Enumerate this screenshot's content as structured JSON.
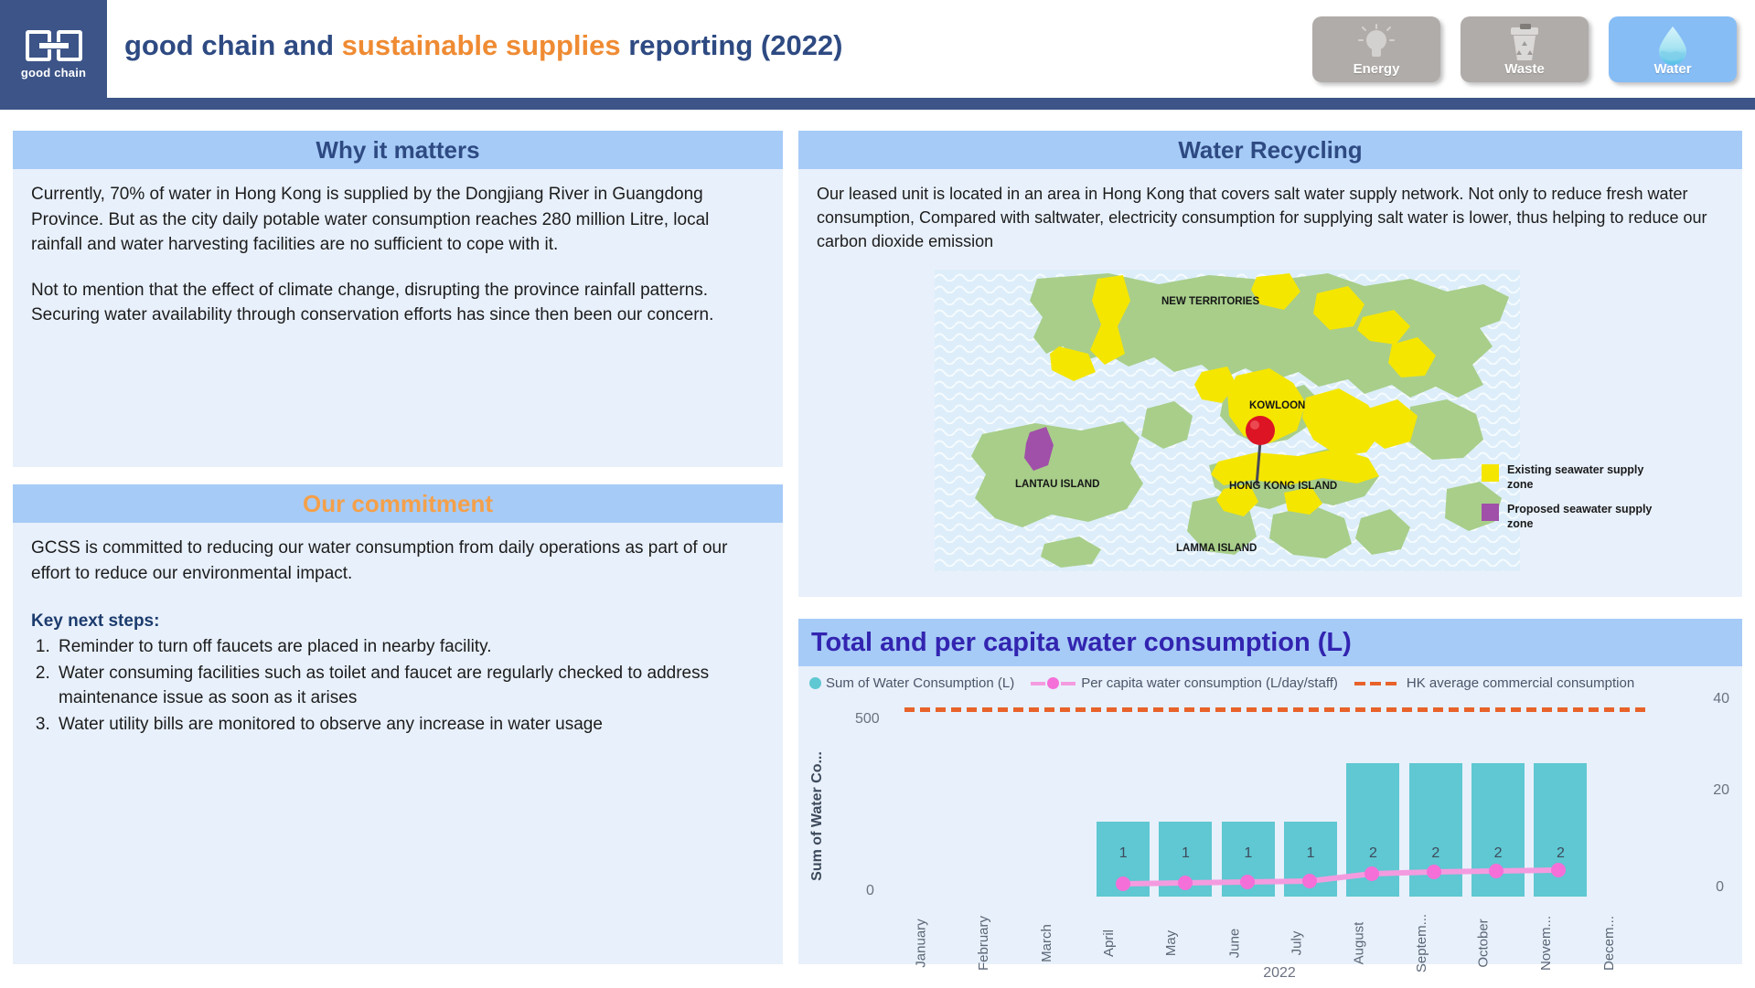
{
  "header": {
    "logo_text": "good chain",
    "title_part1": "good chain and ",
    "title_accent": "sustainable supplies",
    "title_part2": " reporting (2022)",
    "tabs": [
      {
        "label": "Energy",
        "icon": "lightbulb-icon",
        "active": false
      },
      {
        "label": "Waste",
        "icon": "trash-recycle-icon",
        "active": false
      },
      {
        "label": "Water",
        "icon": "water-drop-icon",
        "active": true
      }
    ]
  },
  "why_it_matters": {
    "title": "Why it matters",
    "paragraph1": "Currently, 70% of water in Hong Kong is supplied by the Dongjiang River in Guangdong Province. But as the city daily potable water consumption reaches 280 million Litre, local rainfall and water harvesting facilities are no sufficient to cope with it.",
    "paragraph2": "Not to mention that the effect of climate change, disrupting the province rainfall patterns. Securing water availability through conservation efforts has since then been our concern."
  },
  "our_commitment": {
    "title": "Our commitment",
    "paragraph1": "GCSS is committed to reducing our water consumption from daily operations  as part of our effort to reduce our environmental impact.",
    "key_steps_label": "Key next steps:",
    "steps": [
      "Reminder to turn off faucets are placed in nearby facility.",
      "Water consuming facilities such as toilet and faucet are regularly checked to address maintenance issue as soon as it arises",
      "Water utility bills are monitored to observe any increase in water usage"
    ]
  },
  "water_recycling": {
    "title": "Water Recycling",
    "paragraph": "Our leased unit is located in an area in Hong Kong that covers salt water supply network. Not only to reduce fresh water consumption, Compared with saltwater, electricity consumption for supplying salt water is lower, thus helping to reduce our carbon dioxide emission",
    "map": {
      "region_labels": [
        "NEW TERRITORIES",
        "KOWLOON",
        "HONG KONG ISLAND",
        "LANTAU ISLAND",
        "LAMMA ISLAND"
      ],
      "legend": [
        {
          "label": "Existing seawater supply zone",
          "color": "#f5e600"
        },
        {
          "label": "Proposed seawater supply zone",
          "color": "#a050a8"
        }
      ],
      "marker": "location-pin-marker",
      "colors": {
        "land": "#a8ce8a",
        "sea": "#ddeefa",
        "existing": "#f5e600",
        "proposed": "#a050a8",
        "pin": "#dd1423"
      }
    }
  },
  "chart_panel": {
    "title": "Total and per capita water consumption (L)"
  },
  "chart_data": {
    "type": "bar",
    "title": "Total and per capita water consumption (L)",
    "xlabel": "2022",
    "ylabel": "Sum of Water Co...",
    "ylabel_full": "Sum of Water Consumption (L)",
    "categories": [
      "January",
      "February",
      "March",
      "April",
      "May",
      "June",
      "July",
      "August",
      "Septem...",
      "October",
      "Novem...",
      "Decem..."
    ],
    "y_left_ticks": [
      "0",
      "500"
    ],
    "ylim": [
      0,
      700
    ],
    "y_right_ticks": [
      "0",
      "20",
      "40"
    ],
    "ylim_right": [
      0,
      45
    ],
    "grid": false,
    "legend_position": "top-left",
    "series": [
      {
        "name": "Sum of Water Consumption (L)",
        "type": "bar",
        "color": "#5fc8d2",
        "axis": "left",
        "values": [
          null,
          null,
          null,
          230,
          230,
          230,
          230,
          500,
          500,
          500,
          500,
          null
        ],
        "data_labels": [
          "",
          "",
          "",
          "1",
          "1",
          "1",
          "1",
          "2",
          "2",
          "2",
          "2",
          ""
        ]
      },
      {
        "name": "Per capita water consumption (L/day/staff)",
        "type": "line",
        "color": "#f46fd8",
        "axis": "right",
        "values": [
          null,
          null,
          null,
          1.2,
          1.3,
          1.4,
          1.4,
          2.3,
          2.4,
          2.5,
          2.6,
          null
        ]
      },
      {
        "name": "HK average commercial consumption",
        "type": "dashed-line",
        "color": "#e8622a",
        "axis": "right",
        "constant_value": 35
      }
    ]
  }
}
